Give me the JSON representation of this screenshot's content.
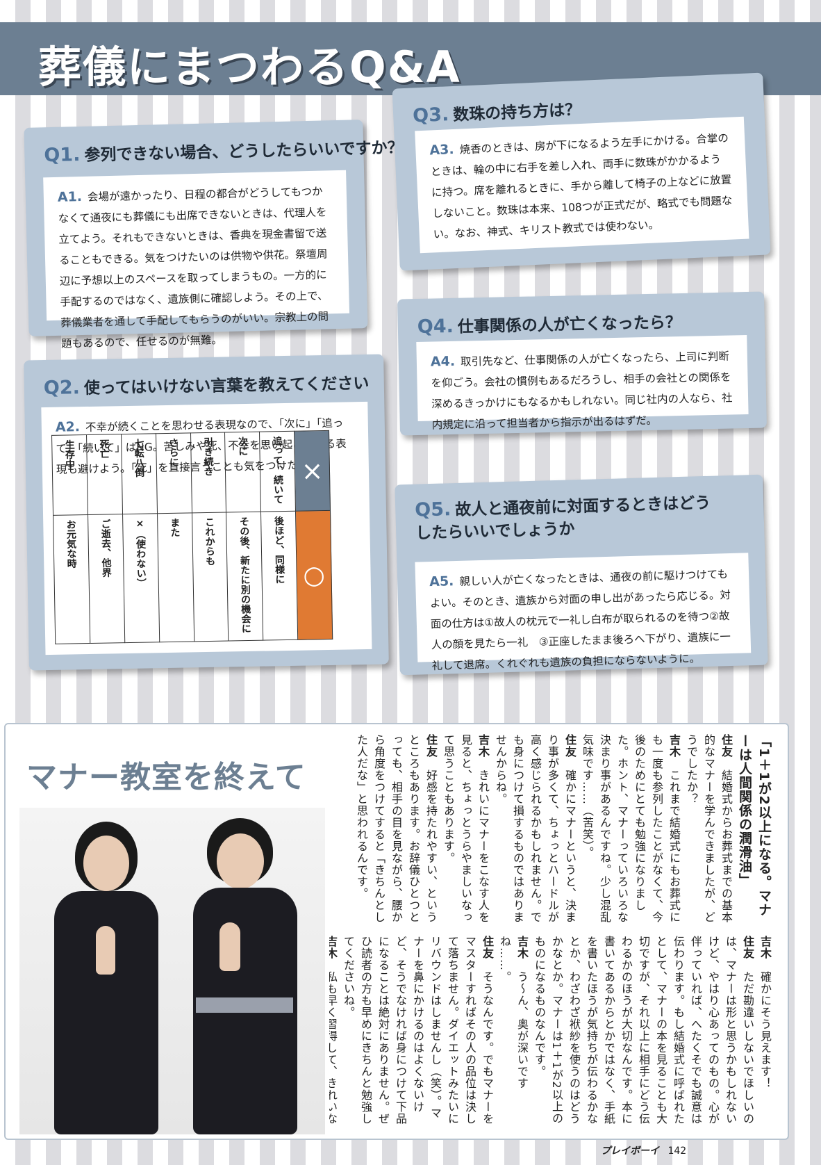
{
  "header": {
    "title": "葬儀にまつわるQ&A"
  },
  "qa": [
    {
      "q_num": "Q1.",
      "q_text": "参列できない場合、どうしたらいいですか？",
      "a_num": "A1.",
      "a_text": "会場が遠かったり、日程の都合がどうしてもつかなくて通夜にも葬儀にも出席できないときは、代理人を立てよう。それもできないときは、香典を現金書留で送ることもできる。気をつけたいのは供物や供花。祭壇周辺に予想以上のスペースを取ってしまうもの。一方的に手配するのではなく、遺族側に確認しよう。その上で、葬儀業者を通して手配してもらうのがいい。宗教上の問題もあるので、任せるのが無難。"
    },
    {
      "q_num": "Q2.",
      "q_text": "使ってはいけない言葉を教えてください",
      "a_num": "A2.",
      "a_text": "不幸が続くことを思わせる表現なので、「次に」「追って」「続いて」はNG。苦しみや死、不幸を思い起こさせる表現も避けよう。「死」を直接言うことも気をつけたい。"
    },
    {
      "q_num": "Q3.",
      "q_text": "数珠の持ち方は？",
      "a_num": "A3.",
      "a_text": "焼香のときは、房が下になるよう左手にかける。合掌のときは、輪の中に右手を差し入れ、両手に数珠がかかるように持つ。席を離れるときに、手から離して椅子の上などに放置しないこと。数珠は本来、108つが正式だが、略式でも問題ない。なお、神式、キリスト教式では使わない。"
    },
    {
      "q_num": "Q4.",
      "q_text": "仕事関係の人が亡くなったら？",
      "a_num": "A4.",
      "a_text": "取引先など、仕事関係の人が亡くなったら、上司に判断を仰ごう。会社の慣例もあるだろうし、相手の会社との関係を深めるきっかけにもなるかもしれない。同じ社内の人なら、社内規定に沿って担当者から指示が出るはずだ。"
    },
    {
      "q_num": "Q5.",
      "q_text": "故人と通夜前に対面するときはどうしたらいいでしょうか",
      "a_num": "A5.",
      "a_text": "親しい人が亡くなったときは、通夜の前に駆けつけてもよい。そのとき、遺族から対面の申し出があったら応じる。対面の仕方は①故人の枕元で一礼し白布が取られるのを待つ②故人の顔を見たら一礼　③正座したまま後ろへ下がり、遺族に一礼して退席。くれぐれも遺族の負担にならないように。"
    }
  ],
  "word_table": {
    "ng_mark": "×",
    "ok_mark": "○",
    "rows": [
      {
        "ng": "追って、続いて",
        "ok": "後ほど、同様に"
      },
      {
        "ng": "次に",
        "ok": "その後、新たに別の機会に"
      },
      {
        "ng": "引き続き",
        "ok": "これからも"
      },
      {
        "ng": "さらに",
        "ok": "また"
      },
      {
        "ng": "七転八倒",
        "ok": "×（使わない）"
      },
      {
        "ng": "死亡",
        "ok": "ご逝去、他界"
      },
      {
        "ng": "生存中",
        "ok": "お元気な時"
      }
    ]
  },
  "bottom": {
    "title": "マナー教室を終えて",
    "lead": "「1＋1が2以上になる。マナーは人間関係の潤滑油」",
    "col1": [
      {
        "speaker": "住友",
        "text": "結婚式からお葬式までの基本的なマナーを学んできましたが、どうでしたか？"
      },
      {
        "speaker": "吉木",
        "text": "これまで結婚式にもお葬式にも一度も参列したことがなくて、今後のためにとても勉強になりました。ホント、マナーっていろいろな決まり事があるんですね。少し混乱気味です……（苦笑）。"
      },
      {
        "speaker": "住友",
        "text": "確かにマナーというと、決まり事が多くて、ちょっとハードルが高く感じられるかもしれません。でも身につけて損するものではありませんからね。"
      },
      {
        "speaker": "吉木",
        "text": "きれいにマナーをこなす人を見ると、ちょっとうらやましいなって思うこともあります。"
      },
      {
        "speaker": "住友",
        "text": "好感を持たれやすい、というところもあります。お辞儀ひとつとっても、相手の目を見ながら、腰から角度をつけてすると「きちんとした人だな」と思われるんです。"
      }
    ],
    "col2": [
      {
        "speaker": "吉木",
        "text": "確かにそう見えます！"
      },
      {
        "speaker": "住友",
        "text": "ただ勘違いしないでほしいのは、マナーは形と思うかもしれないけど、やはり心あってのもの。心が伴っていれば、へたくそでも誠意は伝わります。もし結婚式に呼ばれたとして、マナーの本を見ることも大切ですが、それ以上に相手にどう伝わるかのほうが大切なんです。本に書いてあるからとかではなく、手紙を書いたほうが気持ちが伝わるかなとか、わざわざ袱紗を使うのはどうかなとか。マナーは1＋1が2以上のものになるものなんです。"
      },
      {
        "speaker": "吉木",
        "text": "う～ん、奥が深いですね……。"
      },
      {
        "speaker": "住友",
        "text": "そうなんです。でもマナーをマスターすればその人の品位は決して落ちません。ダイエットみたいにリバウンドはしませんし（笑）。マナーを鼻にかけるのはよくないけど、そうでなければ身につけて下品になることは絶対にありません。ぜひ読者の方も早めにきちんと勉強してくださいね。"
      },
      {
        "speaker": "吉木",
        "text": "私も早く習得して、きれいな女性を目指します!!"
      }
    ]
  },
  "footer": {
    "logo": "プレイボーイ",
    "page": "142"
  }
}
